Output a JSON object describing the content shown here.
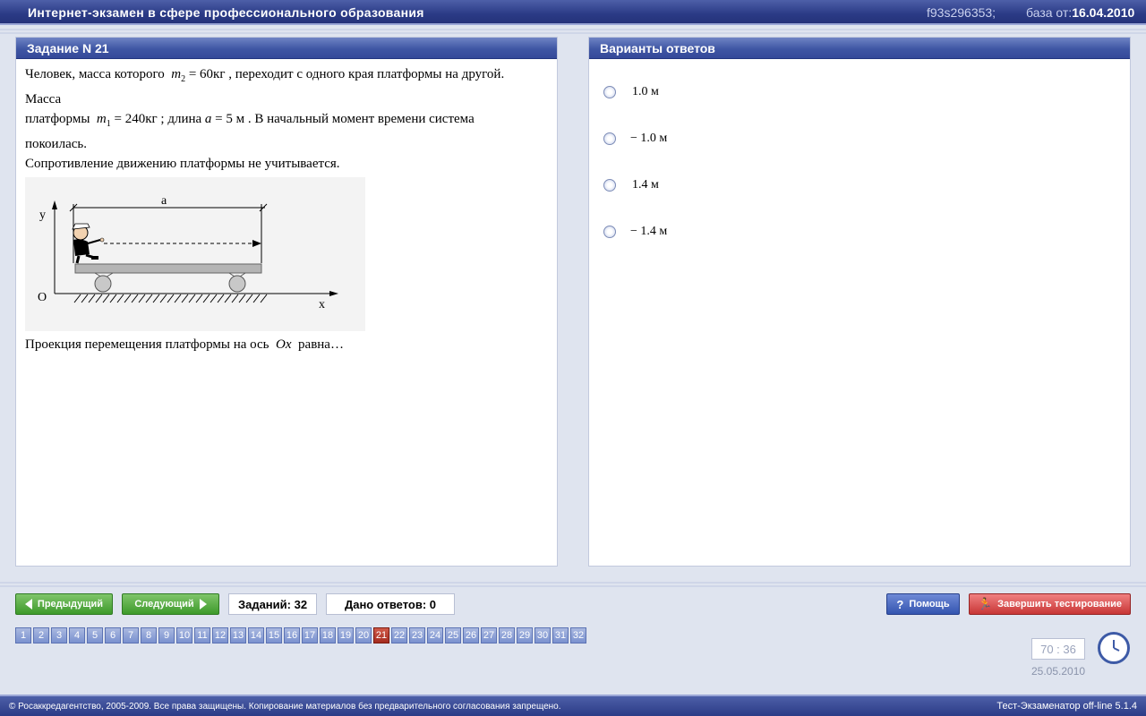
{
  "header": {
    "title": "Интернет-экзамен в сфере профессионального образования",
    "code": "f93s296353;",
    "base_label": "база от:",
    "base_date": "16.04.2010"
  },
  "task": {
    "heading": "Задание N 21",
    "line1_pre": "Человек, масса которого",
    "m2_var": "m",
    "m2_sub": "2",
    "m2_value": " = 60кг",
    "line1_post": ", переходит с одного края платформы на другой.",
    "line2": "Масса",
    "line3_pre": "платформы",
    "m1_var": "m",
    "m1_sub": "1",
    "m1_value": " = 240кг",
    "line3_mid": "; длина",
    "a_var": "a",
    "a_value": " = 5 м",
    "line3_post": ". В начальный момент времени система",
    "line4": "покоилась.",
    "line5": "Сопротивление движению платформы не учитывается.",
    "figure": {
      "label_a": "a",
      "label_y": "y",
      "label_o": "O",
      "label_x": "x"
    },
    "question_pre": "Проекция перемещения платформы на ось",
    "question_var": "Ox",
    "question_post": "равна…"
  },
  "answers": {
    "heading": "Варианты ответов",
    "options": [
      {
        "label": "1.0 м"
      },
      {
        "label": "− 1.0 м"
      },
      {
        "label": "1.4 м"
      },
      {
        "label": "− 1.4 м"
      }
    ]
  },
  "nav": {
    "prev_label": "Предыдущий",
    "next_label": "Следующий",
    "tasks_count": "Заданий: 32",
    "answers_given": "Дано ответов: 0",
    "help_label": "Помощь",
    "finish_label": "Завершить тестирование",
    "numbers": [
      "1",
      "2",
      "3",
      "4",
      "5",
      "6",
      "7",
      "8",
      "9",
      "10",
      "11",
      "12",
      "13",
      "14",
      "15",
      "16",
      "17",
      "18",
      "19",
      "20",
      "21",
      "22",
      "23",
      "24",
      "25",
      "26",
      "27",
      "28",
      "29",
      "30",
      "31",
      "32"
    ],
    "active": "21",
    "timer": "70 : 36",
    "date": "25.05.2010"
  },
  "footer": {
    "copyright": "© Росаккредагентство, 2005-2009. Все права защищены. Копирование материалов без предварительного согласования запрещено.",
    "version": "Тест-Экзаменатор off-line 5.1.4"
  },
  "colors": {
    "accent": "#34499a",
    "active_num": "#a42a1e",
    "green": "#3d9a2b",
    "red": "#c83636"
  }
}
